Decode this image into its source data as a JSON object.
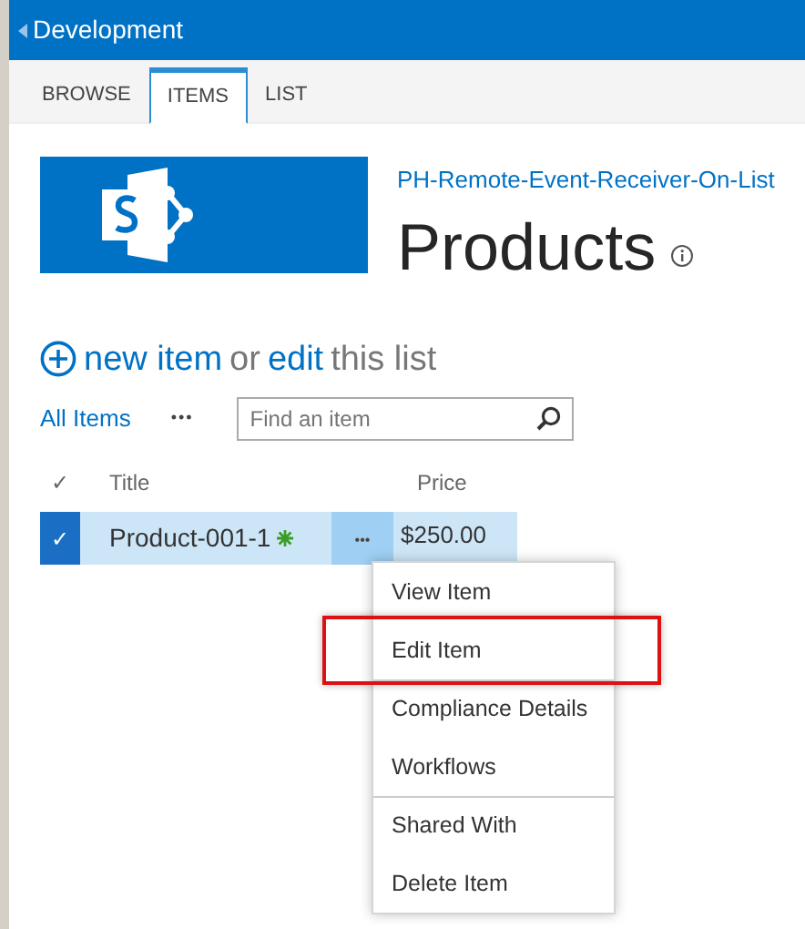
{
  "suite_bar": {
    "back_label": "Development"
  },
  "ribbon_tabs": [
    {
      "label": "BROWSE",
      "selected": false
    },
    {
      "label": "ITEMS",
      "selected": true
    },
    {
      "label": "LIST",
      "selected": false
    }
  ],
  "site_link": "PH-Remote-Event-Receiver-On-List",
  "page_title": "Products",
  "new_item_line": {
    "new_link": "new item",
    "or_text": "or",
    "edit_link": "edit",
    "tail_text": "this list"
  },
  "views": {
    "current": "All Items",
    "more": "•••"
  },
  "search": {
    "placeholder": "Find an item"
  },
  "table": {
    "check_header": "✓",
    "columns": [
      "Title",
      "Price"
    ],
    "rows": [
      {
        "title": "Product-001-1",
        "price": "$250.00",
        "selected": true,
        "is_new": true,
        "more": "•••",
        "menu_open": true
      }
    ]
  },
  "context_menu": [
    {
      "label": "View Item",
      "separator_before": false,
      "highlighted": false
    },
    {
      "label": "Edit Item",
      "separator_before": false,
      "highlighted": true
    },
    {
      "label": "Compliance Details",
      "separator_before": true,
      "highlighted": false
    },
    {
      "label": "Workflows",
      "separator_before": false,
      "highlighted": false
    },
    {
      "label": "Shared With",
      "separator_before": true,
      "highlighted": false
    },
    {
      "label": "Delete Item",
      "separator_before": false,
      "highlighted": false
    }
  ]
}
